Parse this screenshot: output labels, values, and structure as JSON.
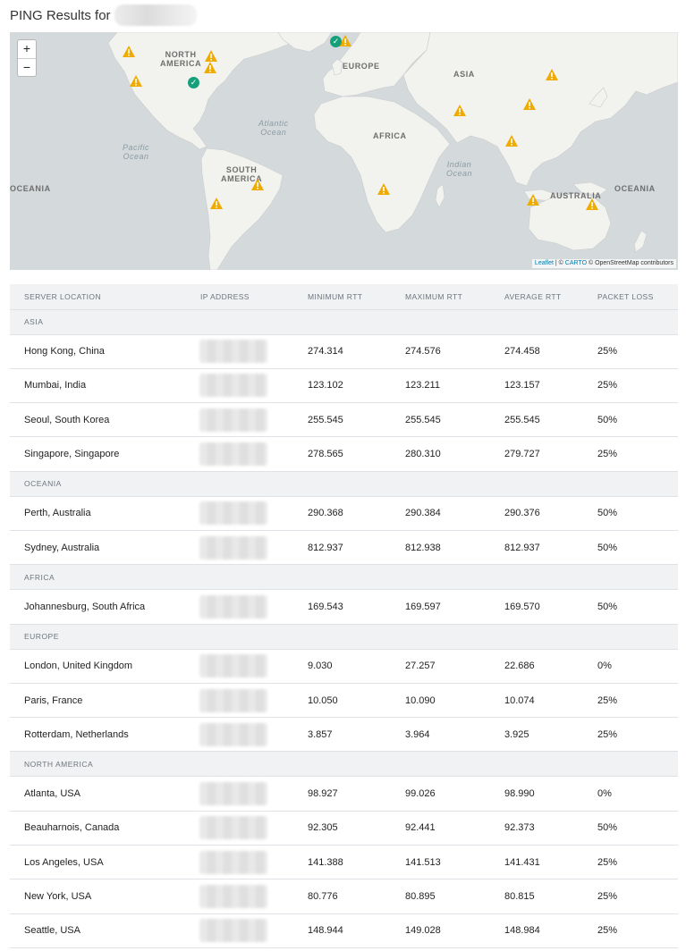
{
  "page": {
    "title": "PING Results for"
  },
  "map": {
    "zoom_in": "+",
    "zoom_out": "−",
    "continents": [
      "NORTH\nAMERICA",
      "EUROPE",
      "ASIA",
      "AFRICA",
      "SOUTH\nAMERICA",
      "AUSTRALIA",
      "OCEANIA",
      "OCEANIA"
    ],
    "oceans": [
      "Atlantic\nOcean",
      "Pacific\nOcean",
      "Indian\nOcean"
    ],
    "attribution": {
      "leaflet": "Leaflet",
      "sep1": " | © ",
      "carto": "CARTO",
      "osm": " © OpenStreetMap contributors"
    },
    "colors": {
      "warning": "#f0ab00",
      "ok": "#16a07a",
      "land": "#f2f2ef",
      "water": "#d4dadc"
    }
  },
  "table": {
    "headers": [
      "SERVER LOCATION",
      "IP ADDRESS",
      "MINIMUM RTT",
      "MAXIMUM RTT",
      "AVERAGE RTT",
      "PACKET LOSS"
    ],
    "groups": [
      {
        "region": "ASIA",
        "rows": [
          {
            "location": "Hong Kong, China",
            "min": "274.314",
            "max": "274.576",
            "avg": "274.458",
            "loss": "25%"
          },
          {
            "location": "Mumbai, India",
            "min": "123.102",
            "max": "123.211",
            "avg": "123.157",
            "loss": "25%"
          },
          {
            "location": "Seoul, South Korea",
            "min": "255.545",
            "max": "255.545",
            "avg": "255.545",
            "loss": "50%"
          },
          {
            "location": "Singapore, Singapore",
            "min": "278.565",
            "max": "280.310",
            "avg": "279.727",
            "loss": "25%"
          }
        ]
      },
      {
        "region": "OCEANIA",
        "rows": [
          {
            "location": "Perth, Australia",
            "min": "290.368",
            "max": "290.384",
            "avg": "290.376",
            "loss": "50%"
          },
          {
            "location": "Sydney, Australia",
            "min": "812.937",
            "max": "812.938",
            "avg": "812.937",
            "loss": "50%"
          }
        ]
      },
      {
        "region": "AFRICA",
        "rows": [
          {
            "location": "Johannesburg, South Africa",
            "min": "169.543",
            "max": "169.597",
            "avg": "169.570",
            "loss": "50%"
          }
        ]
      },
      {
        "region": "EUROPE",
        "rows": [
          {
            "location": "London, United Kingdom",
            "min": "9.030",
            "max": "27.257",
            "avg": "22.686",
            "loss": "0%"
          },
          {
            "location": "Paris, France",
            "min": "10.050",
            "max": "10.090",
            "avg": "10.074",
            "loss": "25%"
          },
          {
            "location": "Rotterdam, Netherlands",
            "min": "3.857",
            "max": "3.964",
            "avg": "3.925",
            "loss": "25%"
          }
        ]
      },
      {
        "region": "NORTH AMERICA",
        "rows": [
          {
            "location": "Atlanta, USA",
            "min": "98.927",
            "max": "99.026",
            "avg": "98.990",
            "loss": "0%"
          },
          {
            "location": "Beauharnois, Canada",
            "min": "92.305",
            "max": "92.441",
            "avg": "92.373",
            "loss": "50%"
          },
          {
            "location": "Los Angeles, USA",
            "min": "141.388",
            "max": "141.513",
            "avg": "141.431",
            "loss": "25%"
          },
          {
            "location": "New York, USA",
            "min": "80.776",
            "max": "80.895",
            "avg": "80.815",
            "loss": "25%"
          },
          {
            "location": "Seattle, USA",
            "min": "148.944",
            "max": "149.028",
            "avg": "148.984",
            "loss": "25%"
          }
        ]
      }
    ]
  }
}
